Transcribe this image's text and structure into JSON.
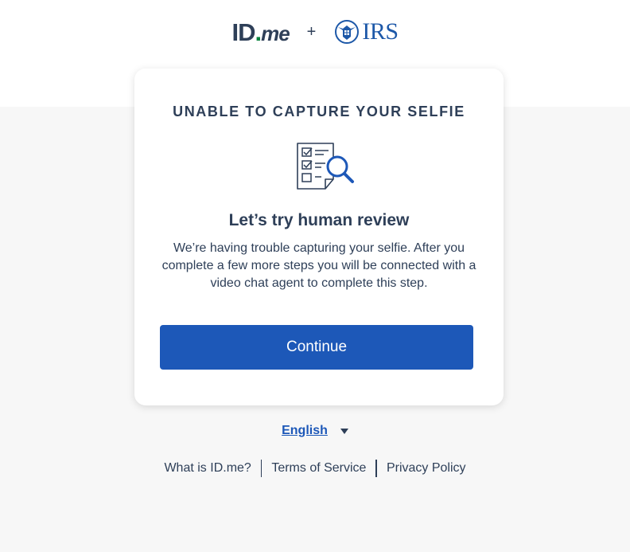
{
  "header": {
    "idme_logo": {
      "id": "ID",
      "dot": ".",
      "me": "me"
    },
    "plus": "+",
    "irs_logo_text": "IRS"
  },
  "card": {
    "heading": "UNABLE TO CAPTURE YOUR SELFIE",
    "icon": "checklist-magnifier-icon",
    "subheading": "Let’s try human review",
    "body": "We’re having trouble capturing your selfie. After you complete a few more steps you will be connected with a video chat agent to complete this step.",
    "continue_label": "Continue"
  },
  "language": {
    "selected": "English"
  },
  "footer": {
    "links": [
      "What is ID.me?",
      "Terms of Service",
      "Privacy Policy"
    ]
  },
  "colors": {
    "primary_blue": "#1d58b8",
    "navy_text": "#2e3f58",
    "idme_green": "#08833d",
    "background": "#f7f7f7"
  }
}
